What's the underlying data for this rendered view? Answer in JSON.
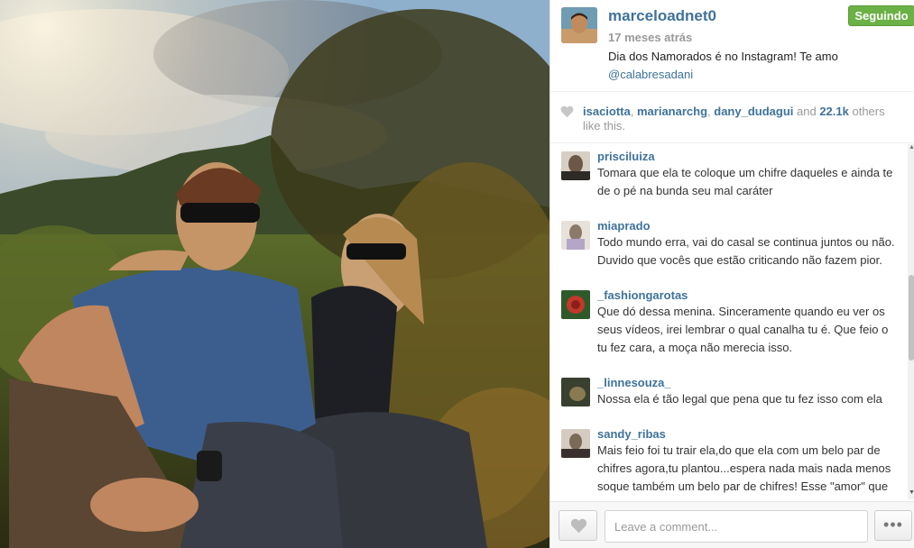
{
  "post": {
    "owner": "marceloadnet0",
    "follow_label": "Seguindo",
    "timestamp": "17 meses atrás",
    "caption_text": "Dia dos Namorados é no Instagram! Te amo",
    "caption_mention": "@calabresadani"
  },
  "likes": {
    "user1": "isaciotta",
    "sep1": ", ",
    "user2": "marianarchg",
    "sep2": ", ",
    "user3": "dany_dudagui",
    "and_text": " and ",
    "count": "22.1k",
    "suffix": " others like this."
  },
  "comments": [
    {
      "user": "prisciluiza",
      "text": "Tomara que ela te coloque um chifre daqueles e ainda te de o pé na bunda seu mal caráter",
      "avatar_color": "#6b5848"
    },
    {
      "user": "miaprado",
      "text": "Todo mundo erra, vai do casal se continua juntos ou não. Duvido que vocês que estão criticando não fazem pior.",
      "avatar_color": "#8a7a6c"
    },
    {
      "user": "_fashiongarotas",
      "text": "Que dó dessa menina. Sinceramente quando eu ver os seus vídeos, irei lembrar o qual canalha tu é. Que feio o tu fez cara, a moça não merecia isso.",
      "avatar_color": "#c0392b"
    },
    {
      "user": "_linnesouza_",
      "text": "Nossa ela é tão legal que pena que tu fez isso com ela",
      "avatar_color": "#4a5a3a"
    },
    {
      "user": "sandy_ribas",
      "text": "Mais feio foi tu trair ela,do que ela com um belo par de chifres agora,tu plantou...espera nada mais nada menos soque também um belo par de chifres! Esse \"amor\" que tu senti por ela,é um \"amor\" que não quero",
      "avatar_color": "#7a6a5a"
    }
  ],
  "footer": {
    "comment_placeholder": "Leave a comment...",
    "more_label": "•••"
  },
  "colors": {
    "link": "#3f729b",
    "follow_button": "#6bb145",
    "muted": "#999999"
  },
  "icons": {
    "heart": "heart-icon",
    "more": "more-options-icon",
    "scroll_up": "▲",
    "scroll_down": "▼"
  }
}
